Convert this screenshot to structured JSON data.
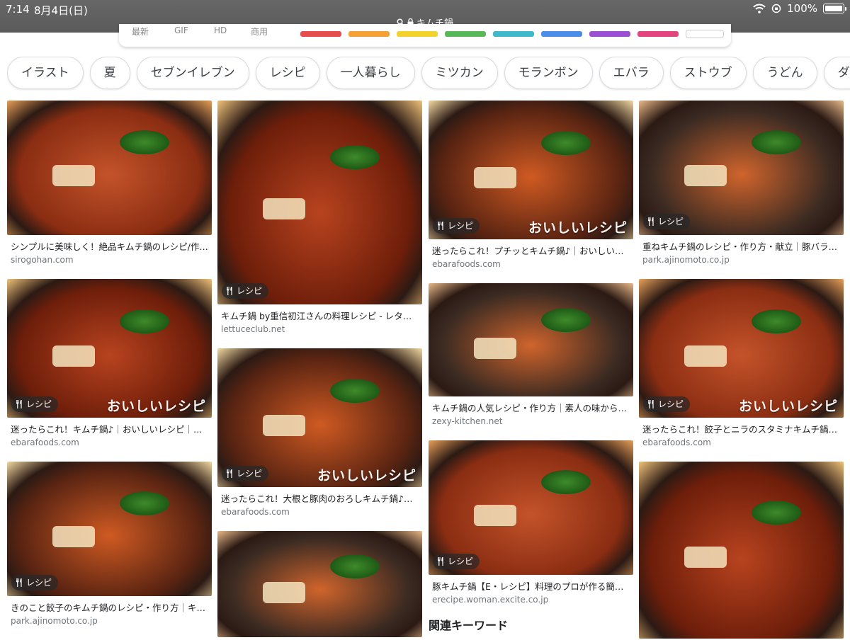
{
  "status_bar": {
    "time": "7:14",
    "date": "8月4日(日)",
    "battery_pct": "100%",
    "url_text": "キムチ鍋"
  },
  "filter_strip": {
    "labels": [
      "最新",
      "GIF",
      "HD",
      "商用"
    ],
    "swatches": [
      "#e84d4d",
      "#f5a033",
      "#f2d22b",
      "#57b857",
      "#3fb8c9",
      "#4a8de8",
      "#9b4fd1",
      "#e2457d"
    ]
  },
  "chips": [
    "イラスト",
    "夏",
    "セブンイレブン",
    "レシピ",
    "一人暮らし",
    "ミツカン",
    "モランボン",
    "エバラ",
    "ストウブ",
    "うどん",
    "ダイソー"
  ],
  "badge_label": "レシピ",
  "watermark": "おいしいレシピ",
  "columns": [
    [
      {
        "title": "シンプルに美味しく！絶品キムチ鍋のレシピ/作り方：白ごはん.com",
        "domain": "sirogohan.com",
        "badge": false,
        "watermark": false
      },
      {
        "title": "迷ったらこれ！キムチ鍋♪｜おいしいレシピ｜エバラ食品",
        "domain": "ebarafoods.com",
        "badge": true,
        "watermark": true
      },
      {
        "title": "きのこと餃子のキムチ鍋のレシピ・作り方｜キムチ鍋",
        "domain": "park.ajinomoto.co.jp",
        "badge": true,
        "watermark": false
      }
    ],
    [
      {
        "title": "キムチ鍋 by重信初江さんの料理レシピ - レタスクラブ",
        "domain": "lettuceclub.net",
        "badge": true,
        "watermark": false
      },
      {
        "title": "迷ったらこれ！大根と豚肉のおろしキムチ鍋♪｜おいしいレシピ",
        "domain": "ebarafoods.com",
        "badge": true,
        "watermark": true
      },
      {
        "title": "",
        "domain": "",
        "badge": false,
        "watermark": false
      }
    ],
    [
      {
        "title": "迷ったらこれ！プチッとキムチ鍋♪｜おいしいレシピ｜エバラ",
        "domain": "ebarafoods.com",
        "badge": true,
        "watermark": true
      },
      {
        "title": "キムチ鍋の人気レシピ・作り方｜素人の味から今日から卒業",
        "domain": "zexy-kitchen.net",
        "badge": false,
        "watermark": false
      },
      {
        "title": "豚キムチ鍋【E・レシピ】料理のプロが作る簡単レシピ",
        "domain": "erecipe.woman.excite.co.jp",
        "badge": true,
        "watermark": false
      }
    ],
    [
      {
        "title": "重ねキムチ鍋のレシピ・作り方・献立｜豚バラ薄切り肉",
        "domain": "park.ajinomoto.co.jp",
        "badge": true,
        "watermark": false
      },
      {
        "title": "迷ったらこれ！餃子とニラのスタミナキムチ鍋♪｜おいしいレシピ",
        "domain": "ebarafoods.com",
        "badge": true,
        "watermark": true
      },
      {
        "title": "",
        "domain": "",
        "badge": false,
        "watermark": false
      }
    ]
  ],
  "related_heading": "関連キーワード",
  "colors": {
    "chip_border": "#dadce0",
    "domain_gray": "#70757a",
    "status_bg": "#5e5e5e"
  }
}
